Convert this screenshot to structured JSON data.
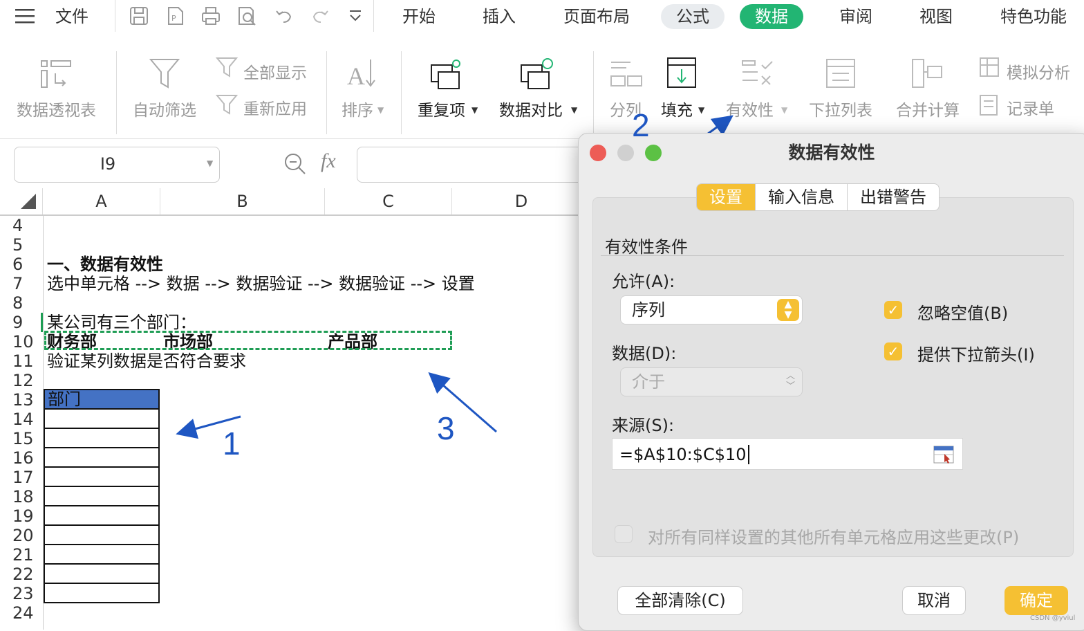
{
  "menubar": {
    "file": "文件",
    "tabs": [
      {
        "label": "开始"
      },
      {
        "label": "插入"
      },
      {
        "label": "页面布局"
      },
      {
        "label": "公式"
      },
      {
        "label": "数据"
      },
      {
        "label": "审阅"
      },
      {
        "label": "视图"
      },
      {
        "label": "特色功能"
      }
    ],
    "active_tab": "数据"
  },
  "ribbon": {
    "pivot": "数据透视表",
    "autofilter": "自动筛选",
    "show_all": "全部显示",
    "reapply": "重新应用",
    "sort": "排序",
    "duplicates": "重复项",
    "compare": "数据对比",
    "split": "分列",
    "fill": "填充",
    "validity": "有效性",
    "dropdown_list": "下拉列表",
    "consolidate": "合并计算",
    "what_if": "模拟分析",
    "record_form": "记录单"
  },
  "formula_bar": {
    "name_box": "I9",
    "fx": "fx",
    "value": ""
  },
  "grid": {
    "columns": [
      "A",
      "B",
      "C",
      "D"
    ],
    "rows": [
      "4",
      "5",
      "6",
      "7",
      "8",
      "9",
      "10",
      "11",
      "12",
      "13",
      "14",
      "15",
      "16",
      "17",
      "18",
      "19",
      "20",
      "21",
      "22",
      "23",
      "24"
    ],
    "cells": {
      "r6": "一、数据有效性",
      "r7": "选中单元格 --> 数据 --> 数据验证 --> 数据验证 --> 设置",
      "r9": "某公司有三个部门：",
      "r10a": "财务部",
      "r10b": "市场部",
      "r10c": "产品部",
      "r11": "验证某列数据是否符合要求",
      "r13": "部门"
    }
  },
  "dialog": {
    "title": "数据有效性",
    "tabs": [
      "设置",
      "输入信息",
      "出错警告"
    ],
    "selected_tab": "设置",
    "section": "有效性条件",
    "allow_label": "允许(A):",
    "allow_value": "序列",
    "ignore_blank": "忽略空值(B)",
    "ignore_blank_checked": true,
    "in_cell_dropdown": "提供下拉箭头(I)",
    "in_cell_dropdown_checked": true,
    "data_label": "数据(D):",
    "data_value": "介于",
    "source_label": "来源(S):",
    "source_value": "=$A$10:$C$10",
    "apply_all": "对所有同样设置的其他所有单元格应用这些更改(P)",
    "apply_all_checked": false,
    "clear_all": "全部清除(C)",
    "cancel": "取消",
    "ok": "确定"
  },
  "annotations": {
    "n1": "1",
    "n2": "2",
    "n3": "3"
  },
  "watermark": "CSDN @yviul",
  "colors": {
    "active_tab": "#22b573",
    "dialog_accent": "#f5c033",
    "header_fill": "#4472c4",
    "selection_border": "#1f9d55",
    "annotation": "#1e56c2"
  }
}
